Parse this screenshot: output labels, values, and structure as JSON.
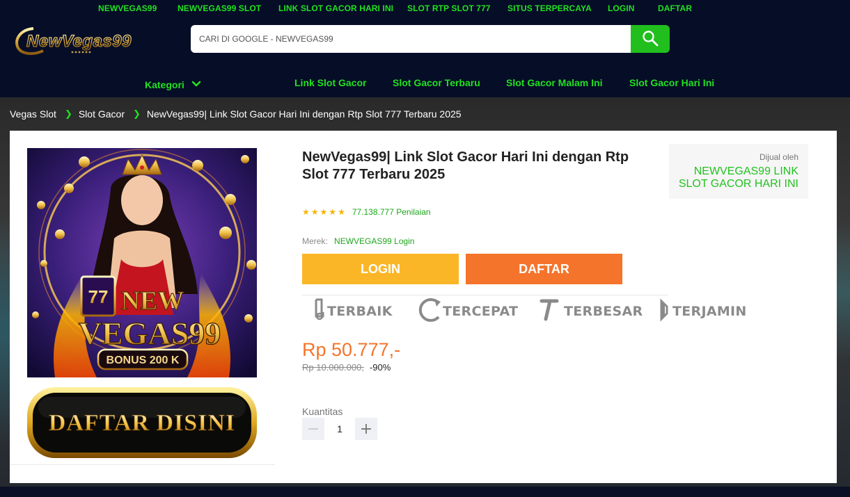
{
  "top_links": [
    "NEWVEGAS99",
    "NEWVEGAS99 SLOT",
    "LINK SLOT GACOR HARI INI",
    "SLOT RTP SLOT 777",
    "SITUS TERPERCAYA",
    "LOGIN",
    "DAFTAR"
  ],
  "logo": {
    "text": "NewVegas99"
  },
  "search": {
    "placeholder": "CARI DI GOOGLE - NEWVEGAS99",
    "icon": "search-icon"
  },
  "nav": {
    "kategori": "Kategori",
    "links": [
      "Link Slot Gacor",
      "Slot Gacor Terbaru",
      "Slot Gacor Malam Ini",
      "Slot Gacor Hari Ini"
    ]
  },
  "breadcrumb": [
    "Vegas Slot",
    "Slot Gacor",
    "NewVegas99| Link Slot Gacor Hari Ini dengan Rtp Slot 777 Terbaru 2025"
  ],
  "product": {
    "title": "NewVegas99| Link Slot Gacor Hari Ini dengan Rtp Slot 777 Terbaru 2025",
    "rating_stars": 5,
    "rating_text": "77.138.777 Penilaian",
    "brand_label": "Merek:",
    "brand_value": "NEWVEGAS99 Login",
    "login_button": "LOGIN",
    "daftar_button": "DAFTAR",
    "features": [
      "TERBAIK",
      "TERCEPAT",
      "TERBESAR",
      "TERJAMIN"
    ],
    "price": "Rp 50.777,-",
    "old_price": "Rp 10.000.000,",
    "discount": "-90%",
    "quantity_label": "Kuantitas",
    "quantity_value": "1",
    "image_text": {
      "line1": "NEW",
      "line2": "VEGAS99",
      "number": "77",
      "bonus": "BONUS 200 K"
    },
    "banner_text": "DAFTAR DISINI"
  },
  "seller": {
    "label": "Dijual oleh",
    "name": "NEWVEGAS99 LINK SLOT GACOR HARI INI"
  },
  "colors": {
    "accent_green": "#21e21f",
    "header_bg": "#060d27",
    "login_yellow": "#fbb627",
    "daftar_orange": "#f4742b",
    "price_orange": "#f4742b"
  }
}
